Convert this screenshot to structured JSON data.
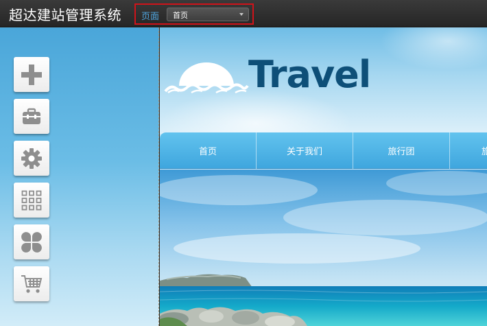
{
  "app": {
    "title": "超达建站管理系统"
  },
  "page_picker": {
    "label": "页面",
    "selected": "首页"
  },
  "toolbar": {
    "tools": [
      {
        "icon": "plus-icon"
      },
      {
        "icon": "toolbox-icon"
      },
      {
        "icon": "gear-icon"
      },
      {
        "icon": "grid-icon"
      },
      {
        "icon": "clover-icon"
      },
      {
        "icon": "cart-icon"
      }
    ]
  },
  "site": {
    "logo_text": "Travel",
    "nav": [
      {
        "label": "首页"
      },
      {
        "label": "关于我们"
      },
      {
        "label": "旅行团"
      },
      {
        "label": "旅"
      }
    ]
  },
  "colors": {
    "highlight_border": "#d0131a",
    "picker_label": "#4fa6e0",
    "logo": "#0e4f78",
    "nav_bar": "#3fa6de"
  }
}
